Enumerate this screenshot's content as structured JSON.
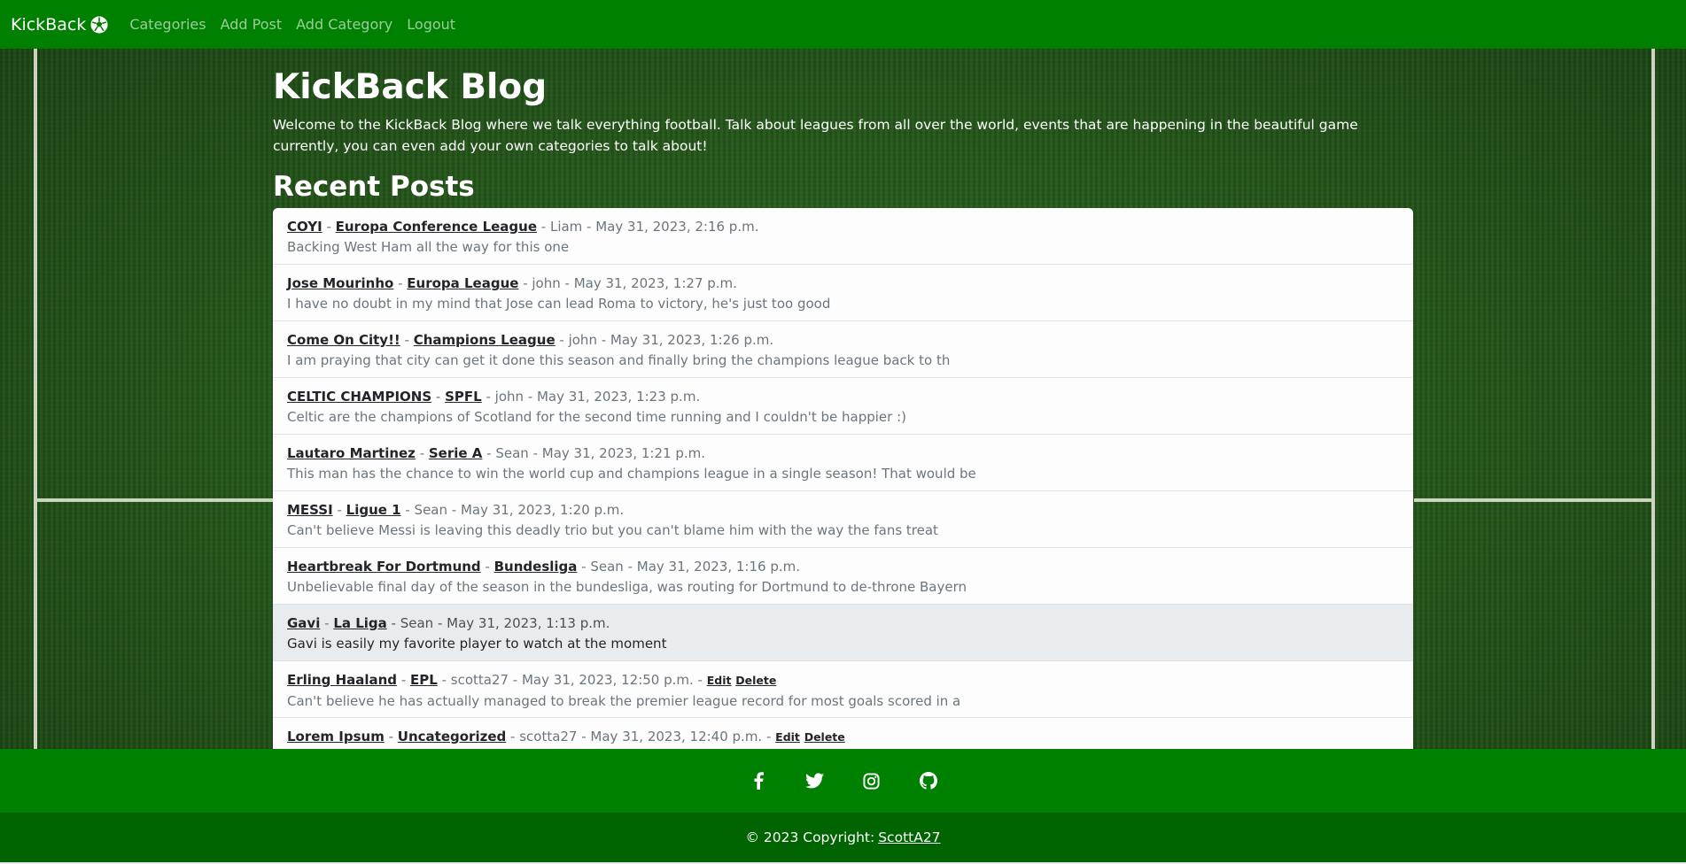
{
  "navbar": {
    "brand": "KickBack",
    "brand_icon": "soccer-ball-icon",
    "links": [
      "Categories",
      "Add Post",
      "Add Category",
      "Logout"
    ]
  },
  "hero": {
    "title": "KickBack Blog",
    "intro": "Welcome to the KickBack Blog where we talk everything football. Talk about leagues from all over the world, events that are happening in the beautiful game currently, you can even add your own categories to talk about!"
  },
  "recent": {
    "title": "Recent Posts",
    "posts": [
      {
        "title": "COYI",
        "category": "Europa Conference League",
        "meta": " - Liam - May 31, 2023, 2:16 p.m.",
        "body": "Backing West Ham all the way for this one"
      },
      {
        "title": "Jose Mourinho",
        "category": "Europa League",
        "meta": " - john - May 31, 2023, 1:27 p.m.",
        "body": "I have no doubt in my mind that Jose can lead Roma to victory, he's just too good"
      },
      {
        "title": "Come On City!!",
        "category": "Champions League",
        "meta": " - john - May 31, 2023, 1:26 p.m.",
        "body": "I am praying that city can get it done this season and finally bring the champions league back to th"
      },
      {
        "title": "CELTIC CHAMPIONS",
        "category": "SPFL",
        "meta": " - john - May 31, 2023, 1:23 p.m.",
        "body": "Celtic are the champions of Scotland for the second time running and I couldn't be happier :)"
      },
      {
        "title": "Lautaro Martinez",
        "category": "Serie A",
        "meta": " - Sean - May 31, 2023, 1:21 p.m.",
        "body": "This man has the chance to win the world cup and champions league in a single season! That would be"
      },
      {
        "title": "MESSI",
        "category": "Ligue 1",
        "meta": " - Sean - May 31, 2023, 1:20 p.m.",
        "body": "Can't believe Messi is leaving this deadly trio but you can't blame him with the way the fans treat"
      },
      {
        "title": "Heartbreak For Dortmund",
        "category": "Bundesliga",
        "meta": " - Sean - May 31, 2023, 1:16 p.m.",
        "body": "Unbelievable final day of the season in the bundesliga, was routing for Dortmund to de-throne Bayern"
      },
      {
        "title": "Gavi",
        "category": "La Liga",
        "meta": " - Sean - May 31, 2023, 1:13 p.m.",
        "body": "Gavi is easily my favorite player to watch at the moment"
      },
      {
        "title": "Erling Haaland",
        "category": "EPL",
        "meta": " - scotta27 - May 31, 2023, 12:50 p.m. - ",
        "body": "Can't believe he has actually managed to break the premier league record for most goals scored in a",
        "edit": "Edit",
        "delete": "Delete"
      },
      {
        "title": "Lorem Ipsum",
        "category": "Uncategorized",
        "meta": " - scotta27 - May 31, 2023, 12:40 p.m. - ",
        "body": "",
        "edit": "Edit",
        "delete": "Delete"
      }
    ]
  },
  "footer": {
    "social_icons": [
      "facebook-icon",
      "twitter-icon",
      "instagram-icon",
      "github-icon"
    ],
    "copyright": "© 2023 Copyright:",
    "author": "ScottA27"
  }
}
